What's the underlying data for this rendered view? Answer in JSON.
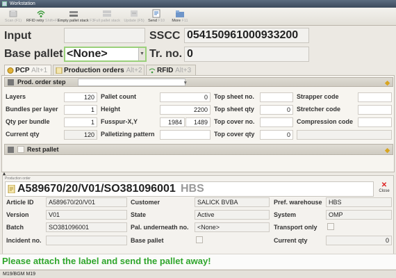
{
  "window": {
    "title": "Workstation"
  },
  "toolbar": {
    "items": [
      {
        "label": "Scan (F1)",
        "icon": "scan-icon",
        "enabled": false
      },
      {
        "label": "RFID retry",
        "shortcut": "Shift+F2",
        "icon": "rfid-icon",
        "enabled": true
      },
      {
        "label": "Empty pallet stack",
        "shortcut": "F3",
        "icon": "pallet-stack-icon",
        "enabled": true
      },
      {
        "label": "Full pallet stack",
        "shortcut": "F4",
        "icon": "full-stack-icon",
        "enabled": false
      },
      {
        "label": "Update (F5)",
        "icon": "update-icon",
        "enabled": false
      },
      {
        "label": "Send",
        "shortcut": "F10",
        "icon": "send-icon",
        "enabled": true
      },
      {
        "label": "More",
        "shortcut": "F11",
        "icon": "more-icon",
        "enabled": true
      }
    ]
  },
  "header": {
    "input_label": "Input",
    "input_value": "",
    "sscc_label": "SSCC",
    "sscc_value": "054150961000933200",
    "base_pallet_label": "Base pallet",
    "base_pallet_value": "<None>",
    "tr_no_label": "Tr. no.",
    "tr_no_value": "0"
  },
  "tabs": [
    {
      "label": "PCP",
      "shortcut": "Alt+1",
      "active": true
    },
    {
      "label": "Production orders",
      "shortcut": "Alt+2",
      "active": false
    },
    {
      "label": "RFID",
      "shortcut": "Alt+3",
      "active": false
    }
  ],
  "pcp": {
    "prod_order_step_label": "Prod. order step",
    "prod_order_step_value": "",
    "fields": {
      "layers": {
        "label": "Layers",
        "value": "120"
      },
      "bundles_per_layer": {
        "label": "Bundles per layer",
        "value": "1"
      },
      "qty_per_bundle": {
        "label": "Qty per bundle",
        "value": "1"
      },
      "current_qty": {
        "label": "Current qty",
        "value": "120"
      },
      "pallet_count": {
        "label": "Pallet count",
        "value": "0"
      },
      "height": {
        "label": "Height",
        "value": "2200"
      },
      "fusspur_label": "Fusspur-X,Y",
      "fusspur_x": "1984",
      "fusspur_y": "1489",
      "palletizing_pattern": {
        "label": "Palletizing pattern",
        "value": ""
      },
      "top_sheet_no": {
        "label": "Top sheet no.",
        "value": ""
      },
      "top_sheet_qty": {
        "label": "Top sheet qty",
        "value": "0"
      },
      "top_cover_no": {
        "label": "Top cover no.",
        "value": ""
      },
      "top_cover_qty": {
        "label": "Top cover qty",
        "value": "0"
      },
      "strapper_code": {
        "label": "Strapper code",
        "value": ""
      },
      "stretcher_code": {
        "label": "Stretcher code",
        "value": ""
      },
      "compression_code": {
        "label": "Compression code",
        "value": ""
      }
    },
    "rest_pallet_label": "Rest pallet"
  },
  "production_order": {
    "group_title": "Production order",
    "title": "A589670/20/V01/SO381096001",
    "title_suffix": "HBS",
    "close_label": "Close",
    "fields": {
      "article_id": {
        "label": "Article ID",
        "value": "A589670/20/V01"
      },
      "version": {
        "label": "Version",
        "value": "V01"
      },
      "batch": {
        "label": "Batch",
        "value": "SO381096001"
      },
      "incident_no": {
        "label": "Incident no.",
        "value": ""
      },
      "customer": {
        "label": "Customer",
        "value": "SALICK BVBA"
      },
      "state": {
        "label": "State",
        "value": "Active"
      },
      "pal_underneath": {
        "label": "Pal. underneath no.",
        "value": "<None>"
      },
      "base_pallet": {
        "label": "Base pallet",
        "checked": false
      },
      "pref_warehouse": {
        "label": "Pref. warehouse",
        "value": "HBS"
      },
      "system": {
        "label": "System",
        "value": "OMP"
      },
      "transport_only": {
        "label": "Transport only",
        "checked": false
      },
      "current_qty": {
        "label": "Current qty",
        "value": "0"
      }
    }
  },
  "status_message": "Please attach the label and send the pallet away!",
  "statusbar": {
    "text": "M19/BGM M19"
  },
  "colors": {
    "status_green": "#2fa62c",
    "focus_green": "#9ad07a",
    "title_blue": "#3c4a5c"
  }
}
